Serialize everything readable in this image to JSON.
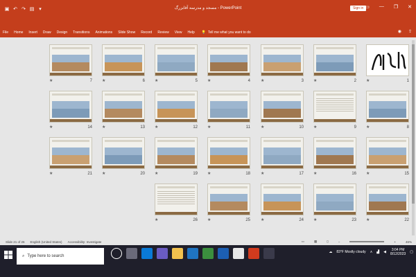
{
  "titlebar": {
    "doc_title": "مسجد و مدرسه آقابزرگ  -  PowerPoint",
    "sign_in": "Sign in"
  },
  "ribbon_tabs": [
    "File",
    "Home",
    "Insert",
    "Draw",
    "Design",
    "Transitions",
    "Animations",
    "Slide Show",
    "Record",
    "Review",
    "View",
    "Help"
  ],
  "tell_me": "Tell me what you want to do",
  "slides": [
    {
      "n": "1",
      "kind": "calligraphy"
    },
    {
      "n": "2",
      "kind": "photo"
    },
    {
      "n": "3",
      "kind": "photo"
    },
    {
      "n": "4",
      "kind": "photo"
    },
    {
      "n": "5",
      "kind": "photo"
    },
    {
      "n": "6",
      "kind": "photo"
    },
    {
      "n": "7",
      "kind": "photo"
    },
    {
      "n": "8",
      "kind": "photo"
    },
    {
      "n": "9",
      "kind": "text"
    },
    {
      "n": "10",
      "kind": "photo"
    },
    {
      "n": "11",
      "kind": "photo"
    },
    {
      "n": "12",
      "kind": "photo"
    },
    {
      "n": "13",
      "kind": "photo"
    },
    {
      "n": "14",
      "kind": "photo"
    },
    {
      "n": "15",
      "kind": "photo"
    },
    {
      "n": "16",
      "kind": "photo"
    },
    {
      "n": "17",
      "kind": "photo"
    },
    {
      "n": "18",
      "kind": "photo"
    },
    {
      "n": "19",
      "kind": "photo"
    },
    {
      "n": "20",
      "kind": "photo"
    },
    {
      "n": "21",
      "kind": "photo"
    },
    {
      "n": "22",
      "kind": "photo"
    },
    {
      "n": "23",
      "kind": "photo"
    },
    {
      "n": "24",
      "kind": "photo"
    },
    {
      "n": "25",
      "kind": "photo"
    },
    {
      "n": "26",
      "kind": "text"
    }
  ],
  "status": {
    "slide": "Slide 21 of 26",
    "language": "English (United States)",
    "accessibility": "Accessibility: Investigate",
    "zoom": "46%"
  },
  "taskbar": {
    "search_placeholder": "Type here to search",
    "weather": "83°F  Mostly cloudy",
    "time": "3:04 PM",
    "date": "8/12/2023"
  },
  "colors": {
    "accent": "#c43e1c",
    "taskbar": "#1f1f2b"
  }
}
